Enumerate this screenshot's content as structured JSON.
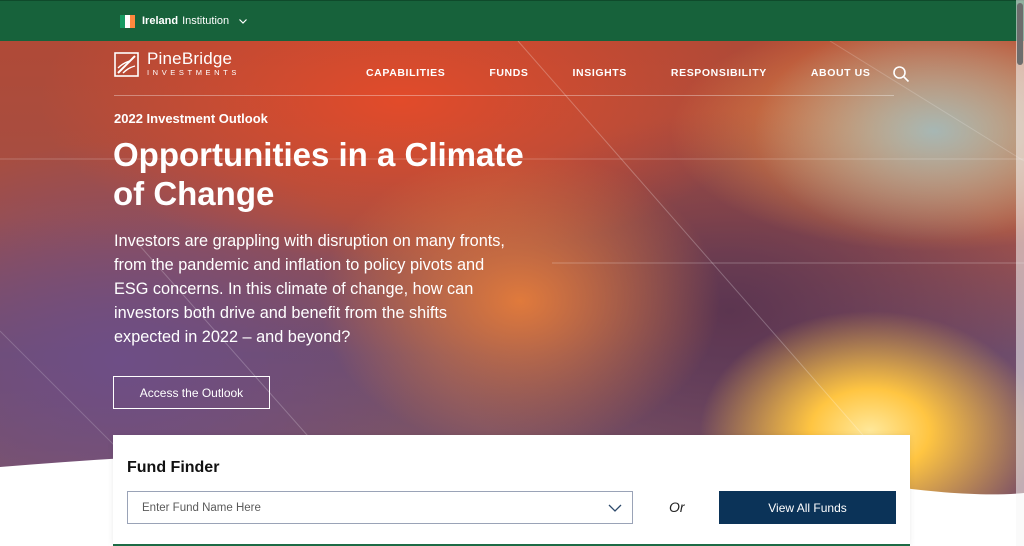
{
  "topbar": {
    "region": "Ireland",
    "audience": "Institution",
    "flag_colors": [
      "#169b62",
      "#ffffff",
      "#ff883e"
    ],
    "chevron_icon": "chevron-down-icon"
  },
  "brand": {
    "name": "PineBridge",
    "tagline": "INVESTMENTS",
    "logo_icon": "pinebridge-logo-icon"
  },
  "nav": {
    "items": [
      {
        "label": "CAPABILITIES"
      },
      {
        "label": "FUNDS"
      },
      {
        "label": "INSIGHTS"
      },
      {
        "label": "RESPONSIBILITY"
      },
      {
        "label": "ABOUT US"
      }
    ],
    "search_icon": "search-icon"
  },
  "hero": {
    "eyebrow": "2022 Investment Outlook",
    "headline": "Opportunities in a Climate of Change",
    "body": "Investors are grappling with disruption on many fronts, from the pandemic and inflation to policy pivots and ESG concerns. In this climate of change, how can investors both drive and benefit from the shifts expected in 2022 – and beyond?",
    "cta_label": "Access the Outlook"
  },
  "fund_finder": {
    "title": "Fund Finder",
    "placeholder": "Enter Fund Name Here",
    "or_label": "Or",
    "view_all_label": "View All Funds",
    "button_color": "#0b3358"
  },
  "colors": {
    "topbar": "#17623b",
    "accent_green": "#1c6b45"
  }
}
